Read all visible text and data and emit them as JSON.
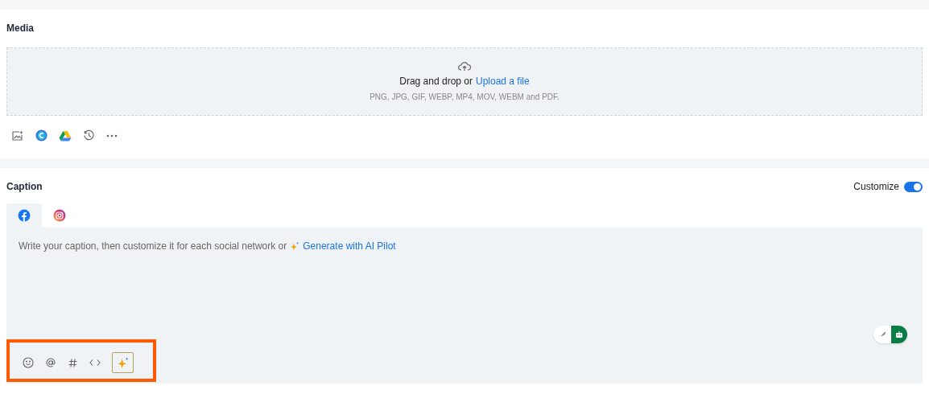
{
  "media": {
    "title": "Media",
    "dropzone": {
      "prompt": "Drag and drop or",
      "link": "Upload a file",
      "hint": "PNG, JPG, GIF, WEBP, MP4, MOV, WEBM and PDF."
    }
  },
  "caption": {
    "title": "Caption",
    "customize": {
      "label": "Customize",
      "on": true
    },
    "tabs": [
      {
        "kind": "facebook",
        "selected": true
      },
      {
        "kind": "instagram",
        "selected": false
      }
    ],
    "editor": {
      "ai_mode": true,
      "placeholder": "Write your caption, then customize it for each social network or",
      "link": "Generate with AI Pilot"
    }
  }
}
